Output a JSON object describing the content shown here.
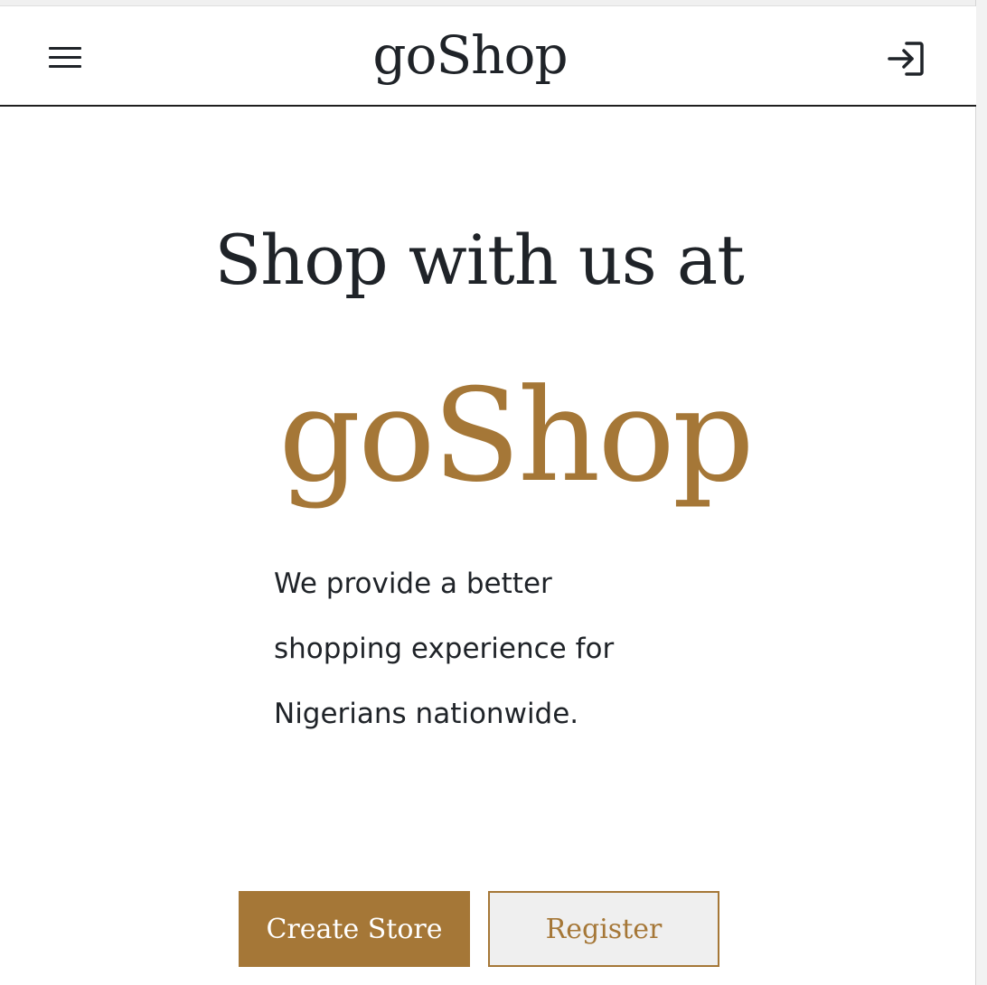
{
  "header": {
    "brand": "goShop",
    "menu_icon": "hamburger-menu-icon",
    "login_icon": "sign-in-icon"
  },
  "hero": {
    "title": "Shop with us at",
    "brand": "goShop",
    "tagline": "We provide a better shopping experience for Nigerians nationwide."
  },
  "actions": {
    "create_store_label": "Create Store",
    "register_label": "Register"
  },
  "colors": {
    "accent": "#a57737",
    "text": "#1f2328",
    "background": "#ffffff"
  }
}
